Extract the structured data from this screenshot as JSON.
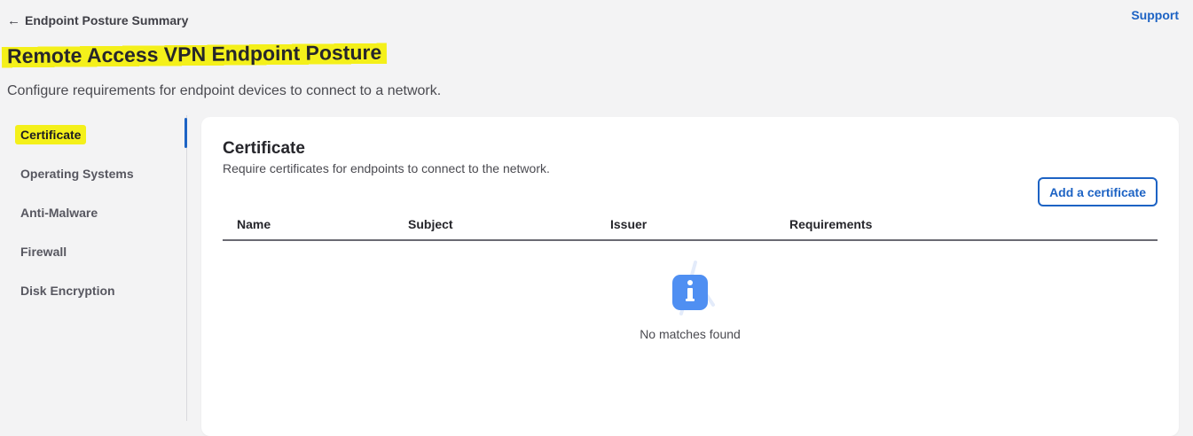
{
  "header": {
    "back_label": "Endpoint Posture Summary",
    "support_label": "Support",
    "title": "Remote Access VPN Endpoint Posture",
    "subtitle": "Configure requirements for endpoint devices to connect to a network."
  },
  "sidebar": {
    "items": [
      {
        "label": "Certificate",
        "active": true
      },
      {
        "label": "Operating Systems",
        "active": false
      },
      {
        "label": "Anti-Malware",
        "active": false
      },
      {
        "label": "Firewall",
        "active": false
      },
      {
        "label": "Disk Encryption",
        "active": false
      }
    ]
  },
  "main": {
    "section_title": "Certificate",
    "section_description": "Require certificates for endpoints to connect to the network.",
    "add_button_label": "Add a certificate",
    "table": {
      "columns": [
        "Name",
        "Subject",
        "Issuer",
        "Requirements"
      ],
      "rows": []
    },
    "empty_state": {
      "icon": "info-icon",
      "message": "No matches found"
    }
  },
  "colors": {
    "accent": "#1d63c4",
    "highlight": "#f4f01a",
    "background": "#f3f3f4",
    "info_icon": "#4f8ff2"
  }
}
